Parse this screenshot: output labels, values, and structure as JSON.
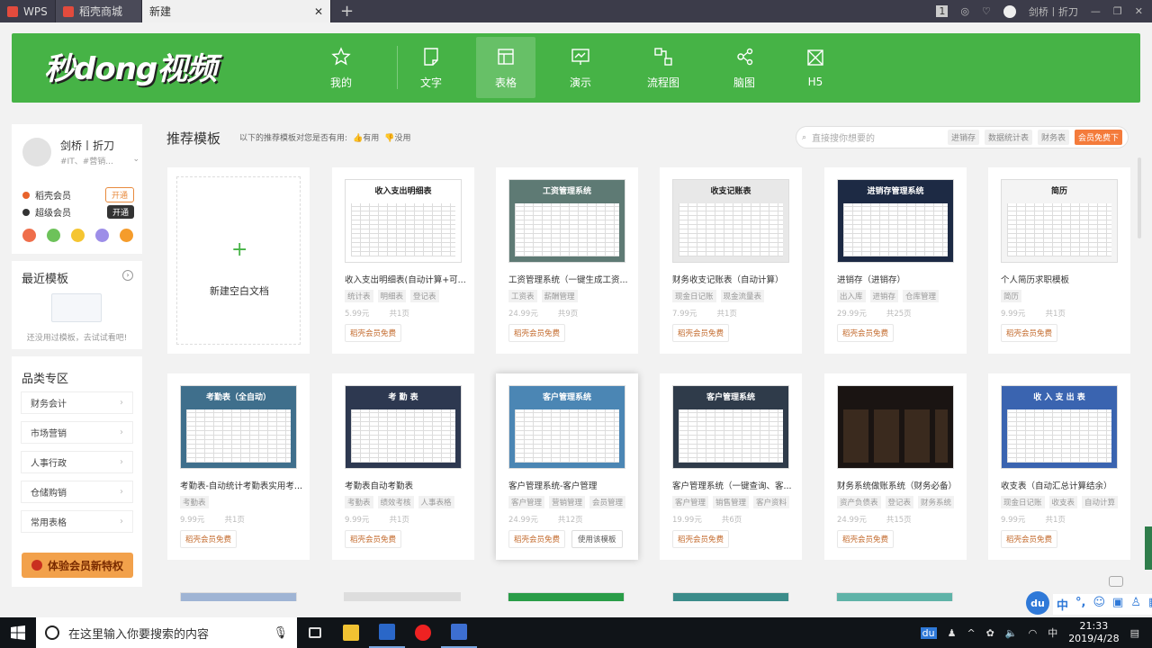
{
  "titlebar": {
    "tab_wps": "WPS",
    "tab_shop": "稻壳商城",
    "tab_new": "新建",
    "user": "剑桥丨折刀",
    "page_badge": "1"
  },
  "banner": {
    "logo": "秒dong视频",
    "nav": [
      {
        "label": "我的",
        "icon": "star-icon"
      },
      {
        "label": "文字",
        "icon": "doc-icon"
      },
      {
        "label": "表格",
        "icon": "table-icon",
        "active": true
      },
      {
        "label": "演示",
        "icon": "slides-icon"
      },
      {
        "label": "流程图",
        "icon": "flowchart-icon"
      },
      {
        "label": "脑图",
        "icon": "mindmap-icon"
      },
      {
        "label": "H5",
        "icon": "h5-icon"
      }
    ]
  },
  "profile": {
    "name": "剑桥丨折刀",
    "tags": "#IT、#营销...",
    "vip1": "稻壳会员",
    "vip1_btn": "开通",
    "vip2": "超级会员",
    "vip2_btn": "开通"
  },
  "recent": {
    "title": "最近模板",
    "empty": "还没用过模板，去试试看吧!"
  },
  "cats": {
    "title": "品类专区",
    "items": [
      "财务会计",
      "市场营销",
      "人事行政",
      "仓储购销",
      "常用表格"
    ],
    "vip": "体验会员新特权"
  },
  "main": {
    "title": "推荐模板",
    "question": "以下的推荐模板对您是否有用:",
    "useful": "有用",
    "useless": "没用",
    "blank": "新建空白文档",
    "use_btn": "使用该模板"
  },
  "search": {
    "placeholder": "直接搜你想要的",
    "tags": [
      "进销存",
      "数据统计表",
      "财务表"
    ],
    "hot": "会员免费下"
  },
  "cards": [
    {
      "title": "收入支出明细表(自动计算+可...",
      "tags": [
        "统计表",
        "明细表",
        "登记表"
      ],
      "price": "5.99元",
      "pages": "共1页",
      "btn": "稻壳会员免费",
      "thumb": "收入支出明细表",
      "theme": "#ffffff"
    },
    {
      "title": "工资管理系统（一键生成工资...",
      "tags": [
        "工资表",
        "薪酬管理"
      ],
      "price": "24.99元",
      "pages": "共9页",
      "btn": "稻壳会员免费",
      "thumb": "工资管理系统",
      "theme": "#5e7a74"
    },
    {
      "title": "财务收支记账表（自动计算）",
      "tags": [
        "现金日记账",
        "现金流量表"
      ],
      "price": "7.99元",
      "pages": "共1页",
      "btn": "稻壳会员免费",
      "thumb": "收支记账表",
      "theme": "#e8e8e8"
    },
    {
      "title": "进销存（进销存）",
      "tags": [
        "出入库",
        "进销存",
        "仓库管理"
      ],
      "price": "29.99元",
      "pages": "共25页",
      "btn": "稻壳会员免费",
      "thumb": "进销存管理系统",
      "theme": "#1d2a44"
    },
    {
      "title": "个人简历求职模板",
      "tags": [
        "简历"
      ],
      "price": "9.99元",
      "pages": "共1页",
      "btn": "稻壳会员免费",
      "thumb": "简历",
      "theme": "#f4f4f4"
    },
    {
      "title": "考勤表-自动统计考勤表实用考...",
      "tags": [
        "考勤表"
      ],
      "price": "9.99元",
      "pages": "共1页",
      "btn": "稻壳会员免费",
      "thumb": "考勤表（全自动）",
      "theme": "#3f6f8c"
    },
    {
      "title": "考勤表自动考勤表",
      "tags": [
        "考勤表",
        "绩效考核",
        "人事表格"
      ],
      "price": "9.99元",
      "pages": "共1页",
      "btn": "稻壳会员免费",
      "thumb": "考 勤 表",
      "theme": "#2d3850"
    },
    {
      "title": "客户管理系统-客户管理",
      "tags": [
        "客户管理",
        "营销管理",
        "会员管理"
      ],
      "price": "24.99元",
      "pages": "共12页",
      "btn": "稻壳会员免费",
      "thumb": "客户管理系统",
      "theme": "#4b86b4"
    },
    {
      "title": "客户管理系统（一键查询、客...",
      "tags": [
        "客户管理",
        "销售管理",
        "客户资料"
      ],
      "price": "19.99元",
      "pages": "共6页",
      "btn": "稻壳会员免费",
      "thumb": "客户管理系统",
      "theme": "#2f3b4a"
    },
    {
      "title": "财务系统做账系统（财务必备）",
      "tags": [
        "资产负债表",
        "登记表",
        "财务系统"
      ],
      "price": "24.99元",
      "pages": "共15页",
      "btn": "稻壳会员免费",
      "thumb": "",
      "theme": "#1a1412"
    },
    {
      "title": "收支表（自动汇总计算结余）",
      "tags": [
        "现金日记账",
        "收支表",
        "自动计算"
      ],
      "price": "9.99元",
      "pages": "共1页",
      "btn": "稻壳会员免费",
      "thumb": "收 入 支 出 表",
      "theme": "#3a64b0"
    }
  ],
  "taskbar": {
    "search": "在这里输入你要搜索的内容",
    "time": "21:33",
    "date": "2019/4/28"
  },
  "ime": {
    "du": "du",
    "zh": "中"
  }
}
